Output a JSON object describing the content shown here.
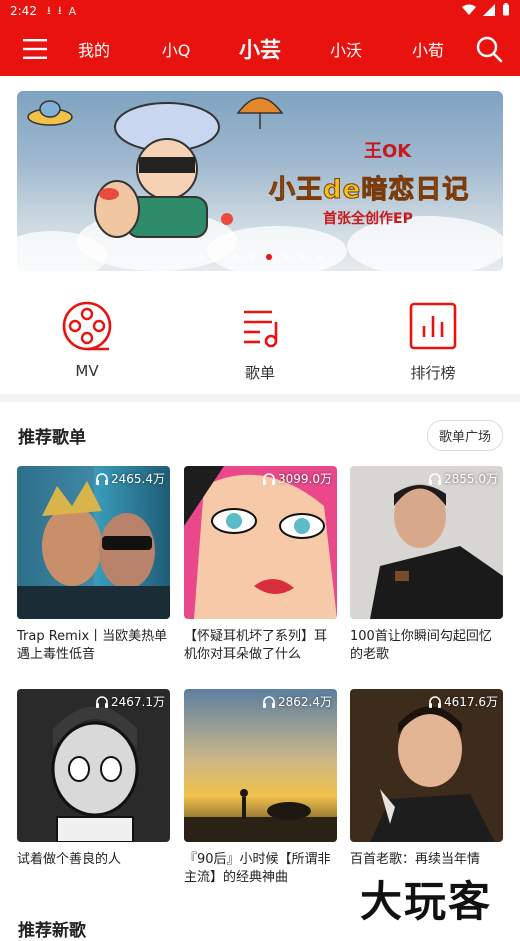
{
  "status_bar": {
    "time": "2:42",
    "badge": "A"
  },
  "nav": {
    "tabs": [
      {
        "label": "我的"
      },
      {
        "label": "小Q"
      },
      {
        "label": "小芸"
      },
      {
        "label": "小沃"
      },
      {
        "label": "小荀"
      }
    ],
    "active_tab": "小芸"
  },
  "banner": {
    "line1": "王OK",
    "line2": "小王de暗恋日记",
    "line3": "首张全创作EP",
    "dot_count": 8,
    "active_dot": 5
  },
  "shortcuts": [
    {
      "label": "MV",
      "icon": "film-reel-icon"
    },
    {
      "label": "歌单",
      "icon": "playlist-icon"
    },
    {
      "label": "排行榜",
      "icon": "chart-icon"
    }
  ],
  "recommended": {
    "title": "推荐歌单",
    "more": "歌单广场",
    "playlists": [
      {
        "plays": "2465.4万",
        "title": "Trap Remix丨当欧美热单遇上毒性低音"
      },
      {
        "plays": "3099.0万",
        "title": "【怀疑耳机坏了系列】耳机你对耳朵做了什么"
      },
      {
        "plays": "2855.0万",
        "title": "100首让你瞬间勾起回忆的老歌"
      },
      {
        "plays": "2467.1万",
        "title": "试着做个善良的人"
      },
      {
        "plays": "2862.4万",
        "title": "『90后』小时候【所谓非主流】的经典神曲"
      },
      {
        "plays": "4617.6万",
        "title": "百首老歌：再续当年情"
      }
    ]
  },
  "next_section": {
    "title": "推荐新歌"
  },
  "watermark": "大玩客",
  "colors": {
    "accent": "#e8130f"
  }
}
